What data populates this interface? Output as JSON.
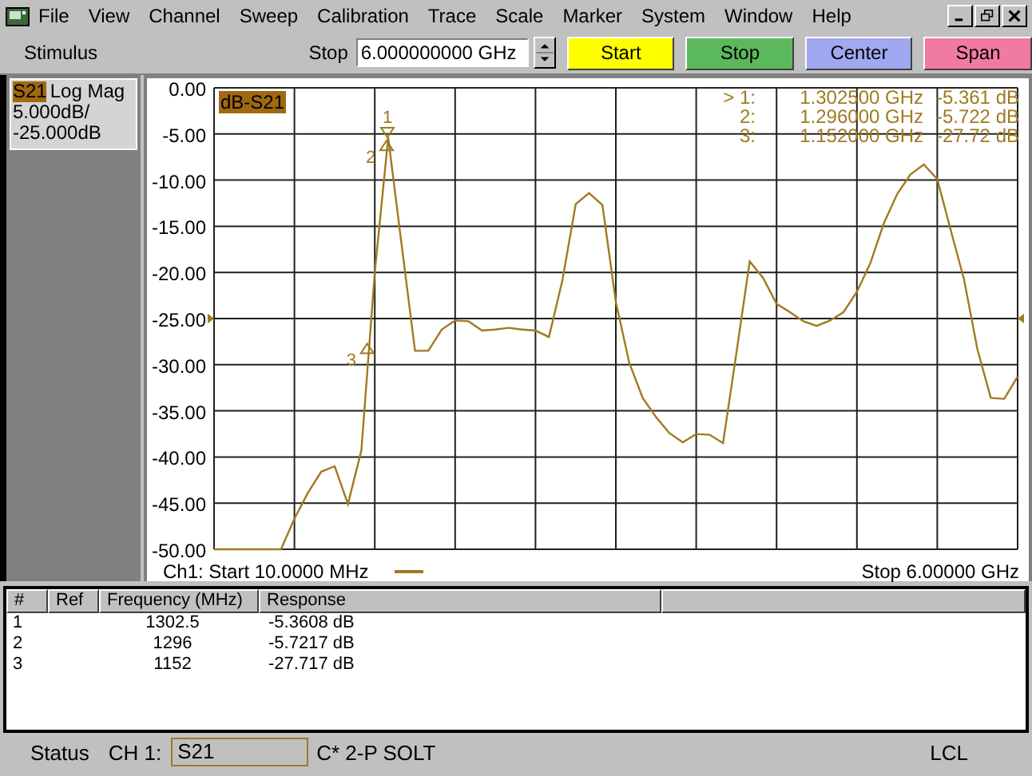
{
  "menu_bar": {
    "items": [
      "File",
      "View",
      "Channel",
      "Sweep",
      "Calibration",
      "Trace",
      "Scale",
      "Marker",
      "System",
      "Window",
      "Help"
    ]
  },
  "toolbar": {
    "title": "Stimulus",
    "field_label": "Stop",
    "field_value": "6.000000000 GHz",
    "buttons": [
      {
        "label": "Start",
        "color": "#ffff00"
      },
      {
        "label": "Stop",
        "color": "#5cb85c"
      },
      {
        "label": "Center",
        "color": "#a0a8f0"
      },
      {
        "label": "Span",
        "color": "#f07aa0"
      }
    ]
  },
  "trace_info": {
    "parameter": "S21",
    "format": "Log Mag",
    "scale": "5.000dB/",
    "reference": "-25.000dB"
  },
  "chart": {
    "trace_label": "dB-S21",
    "marker_readout": [
      {
        "label": "> 1:",
        "frequency": "1.302500 GHz",
        "response": "-5.361 dB"
      },
      {
        "label": "2:",
        "frequency": "1.296000 GHz",
        "response": "-5.722 dB"
      },
      {
        "label": "3:",
        "frequency": "1.152000 GHz",
        "response": "-27.72 dB"
      }
    ],
    "markers": [
      {
        "label": "1",
        "kind": "down"
      },
      {
        "label": "2",
        "kind": "up"
      },
      {
        "label": "3",
        "kind": "up"
      }
    ],
    "start_label": "Ch1: Start  10.0000 MHz",
    "stop_label": "Stop  6.00000 GHz",
    "chart_data": {
      "type": "line",
      "grid": true,
      "ylim": [
        -50,
        0
      ],
      "yticks": [
        {
          "value": 0,
          "label": "0.00"
        },
        {
          "value": -5,
          "label": "-5.00"
        },
        {
          "value": -10,
          "label": "-10.00"
        },
        {
          "value": -15,
          "label": "-15.00"
        },
        {
          "value": -20,
          "label": "-20.00"
        },
        {
          "value": -25,
          "label": "-25.00"
        },
        {
          "value": -30,
          "label": "-30.00"
        },
        {
          "value": -35,
          "label": "-35.00"
        },
        {
          "value": -40,
          "label": "-40.00"
        },
        {
          "value": -45,
          "label": "-45.00"
        },
        {
          "value": -50,
          "label": "-50.00"
        }
      ],
      "categories": [
        null,
        null,
        null,
        null,
        null,
        null,
        null,
        null,
        null,
        null,
        null,
        null,
        null,
        null,
        null,
        null,
        null,
        null,
        null,
        null,
        null,
        null,
        null,
        null,
        null,
        null,
        null,
        null,
        null,
        null,
        null,
        null,
        null,
        null,
        null,
        null,
        null,
        null,
        null,
        null,
        null,
        null,
        null,
        null,
        null,
        null,
        null,
        null,
        null,
        null,
        null,
        null,
        null,
        null,
        null,
        null,
        null,
        null,
        null,
        null,
        null
      ],
      "series": [
        {
          "color": "#a07a20",
          "values": [
            -50,
            -50,
            -50,
            -50,
            -50,
            -50,
            -46.7,
            -43.9,
            -41.6,
            -41,
            -45.1,
            -39.3,
            -20,
            -5.4,
            -17,
            -28.5,
            -28.5,
            -26.2,
            -25.2,
            -25.3,
            -26.3,
            -26.2,
            -26,
            -26.2,
            -26.3,
            -27,
            -20.9,
            -12.6,
            -11.4,
            -12.7,
            -23.2,
            -29.8,
            -33.6,
            -35.7,
            -37.4,
            -38.4,
            -37.5,
            -37.6,
            -38.5,
            -28.8,
            -18.8,
            -20.6,
            -23.4,
            -24.3,
            -25.3,
            -25.8,
            -25.2,
            -24.3,
            -22.1,
            -19,
            -14.7,
            -11.5,
            -9.4,
            -8.3,
            -9.9,
            -15.4,
            -20.8,
            -28.3,
            -33.6,
            -33.7,
            -31.3
          ]
        }
      ]
    }
  },
  "marker_table": {
    "columns": [
      "#",
      "Ref",
      "Frequency (MHz)",
      "Response"
    ],
    "rows": [
      {
        "number": "1",
        "frequency": "1302.5",
        "response": "-5.3608 dB"
      },
      {
        "number": "2",
        "frequency": "1296",
        "response": "-5.7217 dB"
      },
      {
        "number": "3",
        "frequency": "1152",
        "response": "-27.717 dB"
      }
    ]
  },
  "status_bar": {
    "label": "Status",
    "channel": "CH 1:",
    "parameter": "S21",
    "calibration": "C* 2-P SOLT",
    "mode": "LCL"
  }
}
